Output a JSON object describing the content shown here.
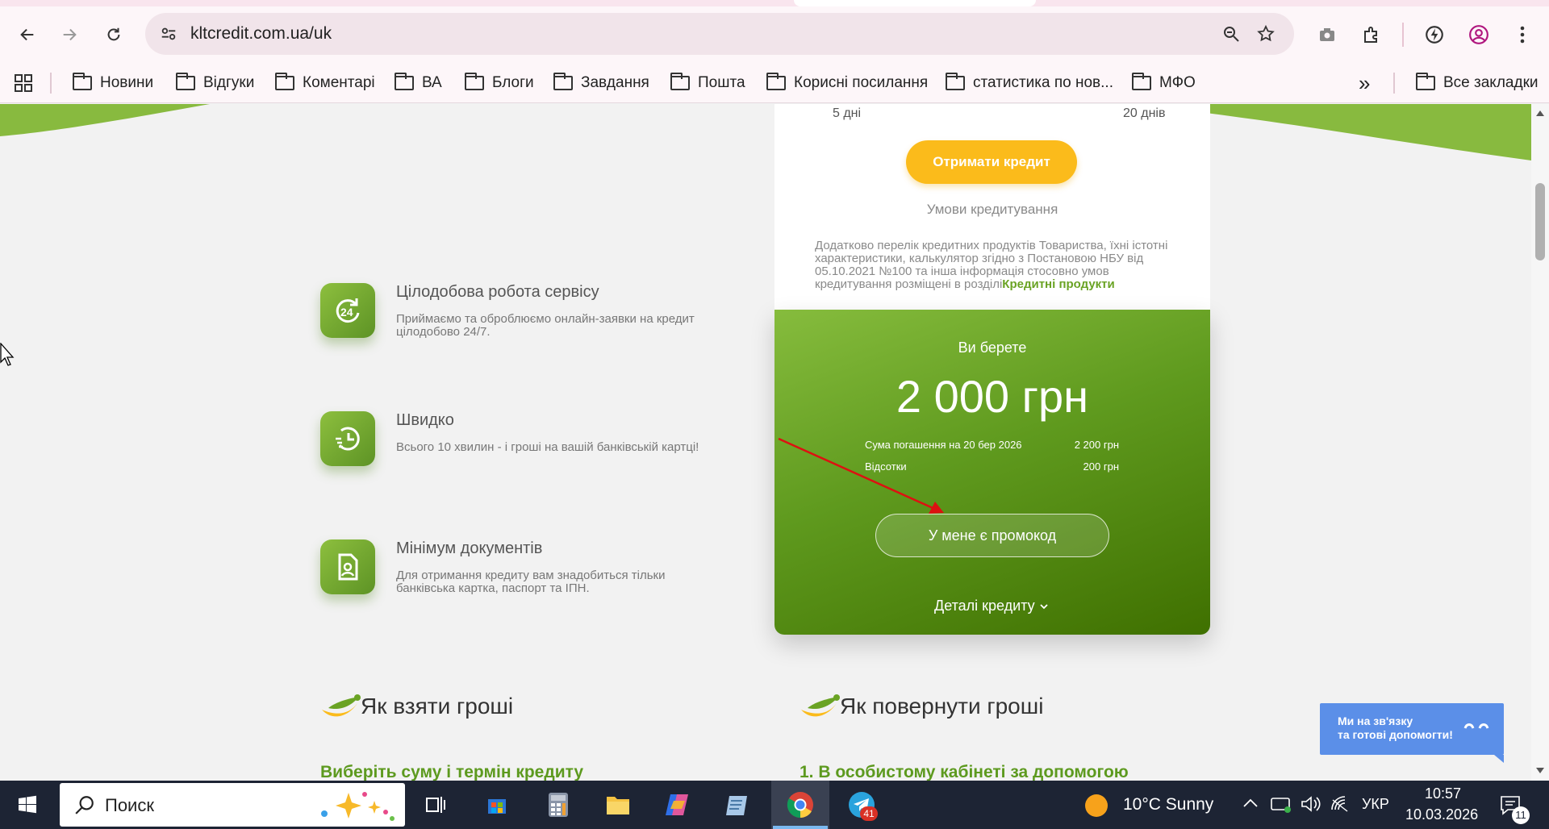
{
  "browser": {
    "url": "kltcredit.com.ua/uk",
    "bookmarks": [
      {
        "label": "Новини"
      },
      {
        "label": "Відгуки"
      },
      {
        "label": "Коментарі"
      },
      {
        "label": "ВА"
      },
      {
        "label": "Блоги"
      },
      {
        "label": "Завдання"
      },
      {
        "label": "Пошта"
      },
      {
        "label": "Корисні посилання"
      },
      {
        "label": "статистика по нов..."
      },
      {
        "label": "МФО"
      }
    ],
    "all_bookmarks": "Все закладки",
    "overflow_label": "»"
  },
  "calculator": {
    "term_min": "5 дні",
    "term_max": "20 днів",
    "get_credit": "Отримати кредит",
    "terms_link": "Умови кредитування",
    "disclaimer": "Додатково перелік кредитних продуктів Товариства, їхні істотні характеристики, калькулятор згідно з Постановою НБУ від 05.10.2021 №100 та інша інформація стосовно умов кредитування розміщені в розділі",
    "disclaimer_link": "Кредитні продукти",
    "you_take": "Ви берете",
    "amount": "2 000 грн",
    "repay_label": "Сума погашення на 20 бер 2026",
    "repay_value": "2 200 грн",
    "interest_label": "Відсотки",
    "interest_value": "200 грн",
    "promo": "У мене є промокод",
    "details": "Деталі кредиту"
  },
  "features": [
    {
      "icon": "24h-icon",
      "title": "Цілодобова робота сервісу",
      "desc": "Приймаємо та оброблюємо онлайн-заявки на кредит цілодобово 24/7."
    },
    {
      "icon": "clock-icon",
      "title": "Швидко",
      "desc": "Всього 10 хвилин - і гроші на вашій банківській картці!"
    },
    {
      "icon": "document-icon",
      "title": "Мінімум документів",
      "desc": "Для отримання кредиту вам знадобиться тільки банківська картка, паспорт та ІПН."
    }
  ],
  "sections": {
    "take_title": "Як взяти гроші",
    "take_step": "Виберіть суму і термін кредиту",
    "return_title": "Як повернути гроші",
    "return_step": "1. В особистому кабінеті за допомогою"
  },
  "chat": {
    "line1": "Ми на зв'язку",
    "line2": "та готові допомогти!"
  },
  "taskbar": {
    "search_placeholder": "Поиск",
    "telegram_badge": "41",
    "weather": "10°C  Sunny",
    "language": "УКР",
    "time": "10:57",
    "date": "10.03.2026",
    "notifications": "11"
  }
}
